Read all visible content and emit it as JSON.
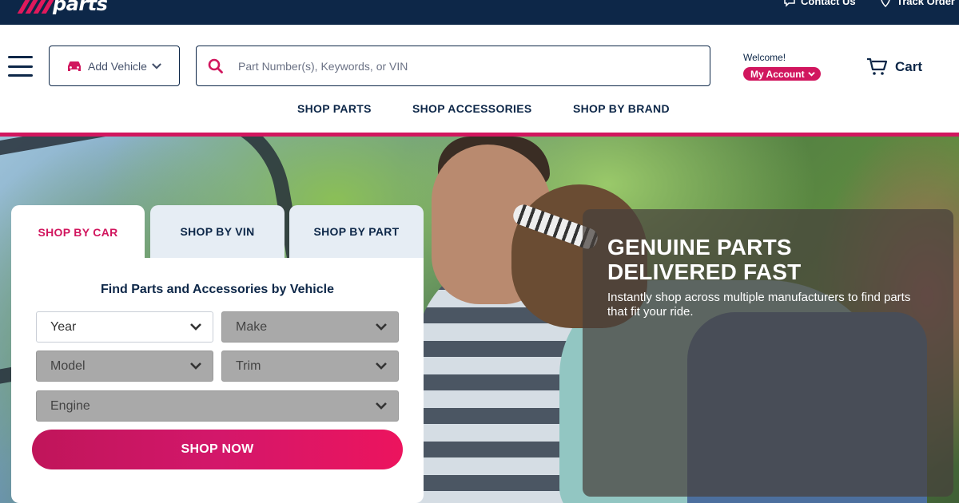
{
  "brand": {
    "logo_text": "parts"
  },
  "top_links": {
    "contact": "Contact Us",
    "track_order": "Track Order"
  },
  "header": {
    "add_vehicle_label": "Add Vehicle",
    "search_placeholder": "Part Number(s), Keywords, or VIN",
    "welcome": "Welcome!",
    "my_account": "My Account",
    "cart": "Cart"
  },
  "nav": {
    "items": [
      "SHOP PARTS",
      "SHOP ACCESSORIES",
      "SHOP BY BRAND"
    ]
  },
  "shop_card": {
    "tabs": [
      "SHOP BY CAR",
      "SHOP BY VIN",
      "SHOP BY PART"
    ],
    "active_tab": "SHOP BY CAR",
    "title": "Find Parts and Accessories by Vehicle",
    "selects": {
      "year": "Year",
      "make": "Make",
      "model": "Model",
      "trim": "Trim",
      "engine": "Engine"
    },
    "button": "SHOP NOW"
  },
  "hero": {
    "headline_line1": "GENUINE PARTS",
    "headline_line2": "DELIVERED FAST",
    "subtext": "Instantly shop across multiple manufacturers to find parts that fit your ride."
  },
  "colors": {
    "navy": "#0d2748",
    "accent_pink": "#d1165e"
  }
}
